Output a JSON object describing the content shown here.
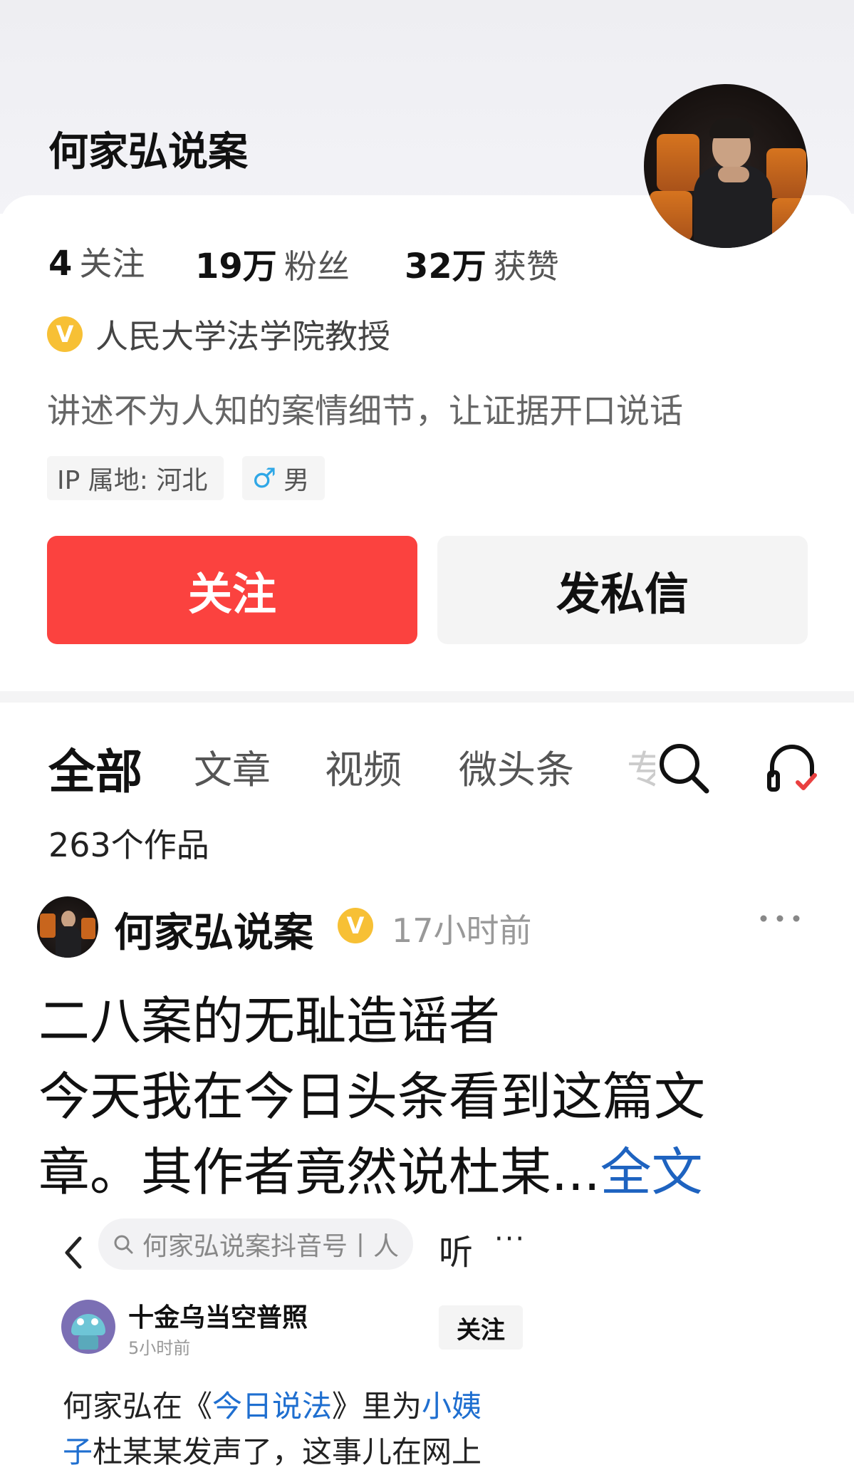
{
  "profile": {
    "name": "何家弘说案",
    "stats": [
      {
        "num": "4",
        "label": "关注"
      },
      {
        "num": "19万",
        "label": "粉丝"
      },
      {
        "num": "32万",
        "label": "获赞"
      }
    ],
    "verify_badge": "V",
    "verification": "人民大学法学院教授",
    "bio": "讲述不为人知的案情细节，让证据开口说话",
    "ip_tag": "IP 属地: 河北",
    "gender_icon": "♂",
    "gender": "男",
    "follow_label": "关注",
    "message_label": "发私信"
  },
  "tabs": {
    "items": [
      "全部",
      "文章",
      "视频",
      "微头条"
    ],
    "overflow_hint": "专",
    "works_count": "263个作品"
  },
  "post": {
    "author": "何家弘说案",
    "verify_badge": "V",
    "time": "17小时前",
    "line1": "二八案的无耻造谣者",
    "line2": "今天我在今日头条看到这篇文",
    "line3": "章。其作者竟然说杜某...",
    "read_more": "全文"
  },
  "embed": {
    "search_placeholder": "何家弘说案抖音号丨人",
    "listen": "听",
    "more": "···",
    "author": "十金乌当空普照",
    "time": "5小时前",
    "follow": "关注",
    "line1_a": "何家弘在《",
    "line1_link": "今日说法",
    "line1_b": "》里为",
    "line1_link2": "小姨",
    "line2_link": "子",
    "line2_b": "杜某某发声了，这事儿在网上"
  },
  "colors": {
    "follow_button": "#fb423f",
    "link": "#1e63c0",
    "verify_badge": "#f7c035",
    "gender_male": "#2fa7e6",
    "listen_check": "#e94040"
  },
  "icons": {
    "search": "search-icon",
    "listen": "headphones-check-icon",
    "more": "more-dots-icon",
    "back": "back-chevron-icon"
  }
}
